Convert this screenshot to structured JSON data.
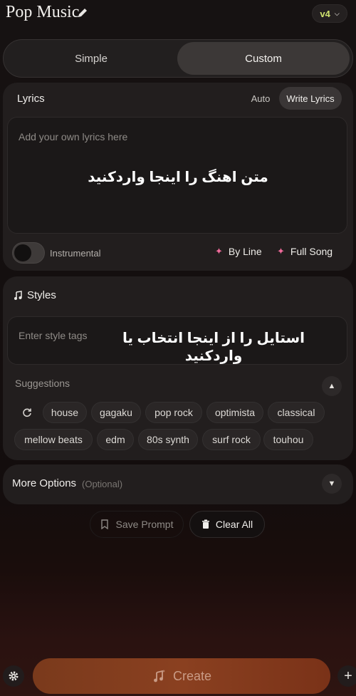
{
  "header": {
    "title": "Pop Music",
    "version": "v4"
  },
  "mode": {
    "simple": "Simple",
    "custom": "Custom"
  },
  "lyrics": {
    "label": "Lyrics",
    "auto": "Auto",
    "write": "Write Lyrics",
    "placeholder": "Add your own lyrics here",
    "overlay": "متن اهنگ را اینجا واردکنید",
    "instrumental": "Instrumental",
    "by_line": "By Line",
    "full_song": "Full Song"
  },
  "styles": {
    "label": "Styles",
    "placeholder": "Enter style tags",
    "overlay": "استایل را از اینجا انتخاب یا واردکنید",
    "suggestions_label": "Suggestions",
    "chips": [
      "house",
      "gagaku",
      "pop rock",
      "optimista",
      "classical",
      "mellow beats",
      "edm",
      "80s synth",
      "surf rock",
      "touhou"
    ]
  },
  "more": {
    "label": "More Options",
    "optional": "(Optional)"
  },
  "actions": {
    "save": "Save Prompt",
    "clear": "Clear All"
  },
  "bottom": {
    "create": "Create"
  },
  "colors": {
    "accent_version": "#cfe36e",
    "sparkle": "#f06b9b",
    "create_bg": "#8a4020"
  }
}
